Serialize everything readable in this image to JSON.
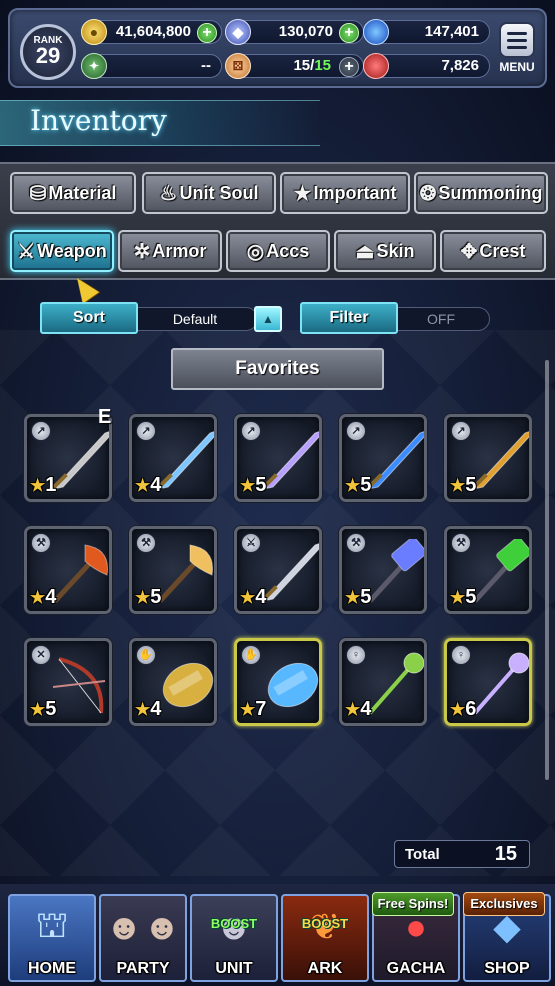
{
  "hud": {
    "rank_label": "RANK",
    "rank_value": "29",
    "gil": "41,604,800",
    "lapis": "130,070",
    "blue_orbs": "147,401",
    "friend_points": "--",
    "stamina": "15",
    "stamina_max": "15",
    "red_orbs": "7,826",
    "menu_label": "MENU"
  },
  "title": "Inventory",
  "tabs_row1": [
    {
      "label": "Material",
      "icon": "bag-icon"
    },
    {
      "label": "Unit Soul",
      "icon": "flame-icon"
    },
    {
      "label": "Important",
      "icon": "star-icon"
    },
    {
      "label": "Summoning",
      "icon": "summon-icon"
    }
  ],
  "tabs_row2": [
    {
      "label": "Weapon",
      "icon": "sword-icon",
      "active": true
    },
    {
      "label": "Armor",
      "icon": "armor-icon",
      "active": false
    },
    {
      "label": "Accs",
      "icon": "necklace-icon",
      "active": false
    },
    {
      "label": "Skin",
      "icon": "hanger-icon",
      "active": false
    },
    {
      "label": "Crest",
      "icon": "crest-icon",
      "active": false
    }
  ],
  "controls": {
    "sort_label": "Sort",
    "sort_value": "Default",
    "filter_label": "Filter",
    "filter_value": "OFF",
    "favorites_label": "Favorites"
  },
  "equipped_mark": "E",
  "items": [
    {
      "type": "sword",
      "rarity": "1",
      "color": "#c8c8c8",
      "gold": false
    },
    {
      "type": "sword",
      "rarity": "4",
      "color": "#7ec6ff",
      "gold": false
    },
    {
      "type": "sword",
      "rarity": "5",
      "color": "#b8a0ff",
      "gold": false
    },
    {
      "type": "sword",
      "rarity": "5",
      "color": "#3c8cff",
      "gold": false
    },
    {
      "type": "sword",
      "rarity": "5",
      "color": "#e0a030",
      "gold": false
    },
    {
      "type": "axe",
      "rarity": "4",
      "color": "#e05a20",
      "gold": false
    },
    {
      "type": "axe",
      "rarity": "5",
      "color": "#f0c060",
      "gold": false
    },
    {
      "type": "greatsword",
      "rarity": "4",
      "color": "#d0d4e0",
      "gold": false
    },
    {
      "type": "hammer",
      "rarity": "5",
      "color": "#6a7cff",
      "gold": false
    },
    {
      "type": "hammer",
      "rarity": "5",
      "color": "#3fcf3a",
      "gold": false
    },
    {
      "type": "bow",
      "rarity": "5",
      "color": "#b03a2a",
      "gold": false
    },
    {
      "type": "fist",
      "rarity": "4",
      "color": "#d8b040",
      "gold": false
    },
    {
      "type": "fist",
      "rarity": "7",
      "color": "#58b8ff",
      "gold": true
    },
    {
      "type": "staff",
      "rarity": "4",
      "color": "#8ad048",
      "gold": false
    },
    {
      "type": "staff",
      "rarity": "6",
      "color": "#c8b0ff",
      "gold": true
    }
  ],
  "total_label": "Total",
  "total_value": "15",
  "nav": [
    {
      "label": "HOME",
      "badge": ""
    },
    {
      "label": "PARTY",
      "badge": ""
    },
    {
      "label": "UNIT",
      "badge": "",
      "boost": "BOOST"
    },
    {
      "label": "ARK",
      "badge": "",
      "boost": "BOOST"
    },
    {
      "label": "GACHA",
      "badge": "Free Spins!"
    },
    {
      "label": "SHOP",
      "badge": "Exclusives"
    }
  ]
}
